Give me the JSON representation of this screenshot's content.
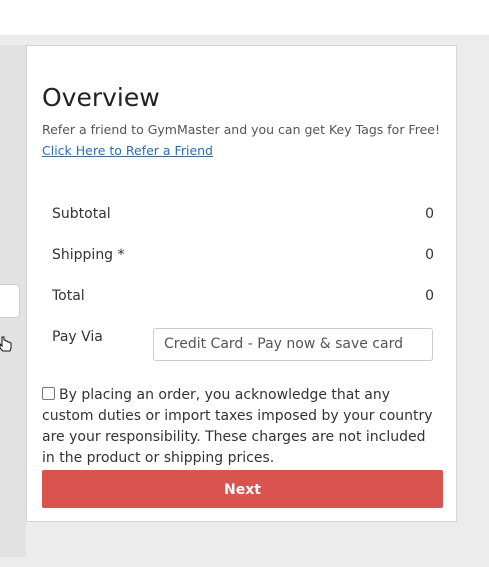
{
  "overview": {
    "title": "Overview",
    "referral_text": "Refer a friend to GymMaster and you can get Key Tags for Free!",
    "referral_link": "Click Here to Refer a Friend"
  },
  "summary": {
    "subtotal_label": "Subtotal",
    "subtotal_value": "0",
    "shipping_label": "Shipping *",
    "shipping_value": "0",
    "total_label": "Total",
    "total_value": "0"
  },
  "payment": {
    "label": "Pay Via",
    "selected": "Credit Card - Pay now & save card"
  },
  "acknowledgement": {
    "checked": false,
    "text": "By placing an order, you acknowledge that any custom duties or import taxes imposed by your country are your responsibility. These charges are not included in the product or shipping prices."
  },
  "actions": {
    "next_label": "Next"
  },
  "colors": {
    "primary_button": "#d9534f",
    "link": "#2a6dbb",
    "background": "#ececec"
  }
}
